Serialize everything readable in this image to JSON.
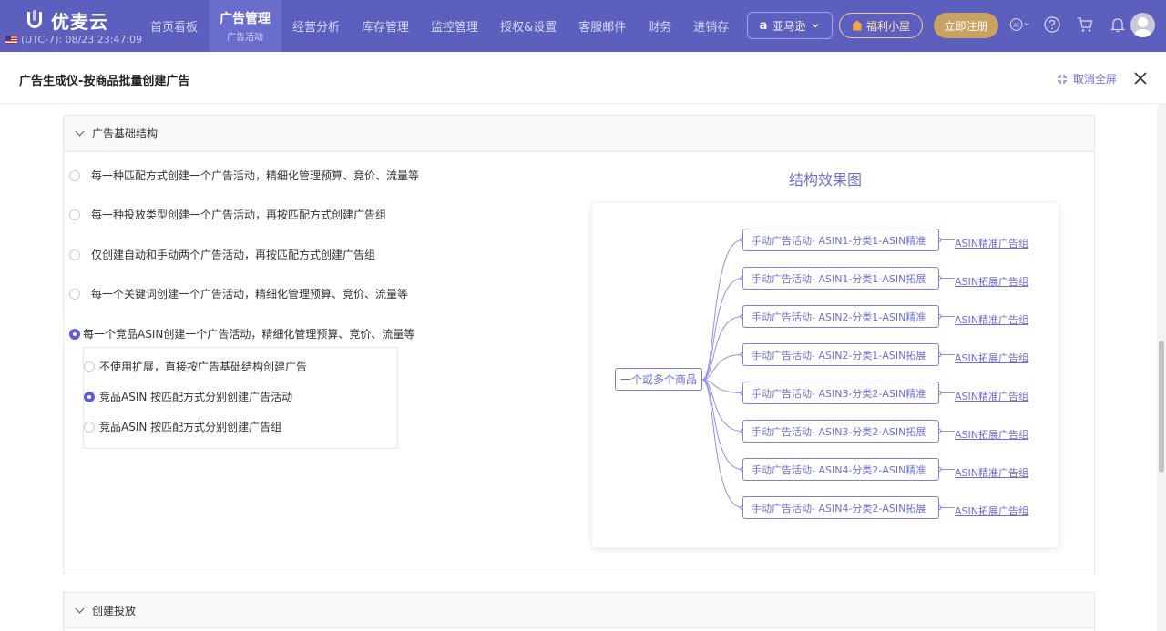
{
  "brand": {
    "name": "优麦云"
  },
  "timezone": "(UTC-7): 08/23 23:47:09",
  "nav": [
    {
      "label": "首页看板",
      "sub": ""
    },
    {
      "label": "广告管理",
      "sub": "广告活动"
    },
    {
      "label": "经营分析",
      "sub": ""
    },
    {
      "label": "库存管理",
      "sub": ""
    },
    {
      "label": "监控管理",
      "sub": ""
    },
    {
      "label": "授权&设置",
      "sub": ""
    },
    {
      "label": "客服邮件",
      "sub": ""
    },
    {
      "label": "财务",
      "sub": ""
    },
    {
      "label": "进销存",
      "sub": ""
    }
  ],
  "active_nav": "广告管理",
  "store_select": {
    "label": "亚马逊"
  },
  "welfare": "福利小屋",
  "register": "立即注册",
  "top_icons": [
    "ai-icon",
    "help-icon",
    "cart-icon",
    "bell-icon",
    "avatar"
  ],
  "dialog": {
    "title": "广告生成仪-按商品批量创建广告",
    "exit_fullscreen": "取消全屏"
  },
  "section1": {
    "title": "广告基础结构",
    "options": [
      {
        "label": "每一种匹配方式创建一个广告活动，精细化管理预算、竞价、流量等",
        "selected": false
      },
      {
        "label": "每一种投放类型创建一个广告活动，再按匹配方式创建广告组",
        "selected": false
      },
      {
        "label": "仅创建自动和手动两个广告活动，再按匹配方式创建广告组",
        "selected": false
      },
      {
        "label": "每一个关键词创建一个广告活动，精细化管理预算、竞价、流量等",
        "selected": false
      },
      {
        "label": "每一个竞品ASIN创建一个广告活动，精细化管理预算、竞价、流量等",
        "selected": true
      }
    ],
    "sub_options": [
      {
        "label": "不使用扩展，直接按广告基础结构创建广告",
        "selected": false
      },
      {
        "label": "竞品ASIN 按匹配方式分别创建广告活动",
        "selected": true
      },
      {
        "label": "竞品ASIN 按匹配方式分别创建广告组",
        "selected": false
      }
    ]
  },
  "diagram": {
    "title": "结构效果图",
    "root": "一个或多个商品",
    "campaigns": [
      {
        "label": "手动广告活动- ASIN1-分类1-ASIN精准",
        "group": "ASIN精准广告组"
      },
      {
        "label": "手动广告活动- ASIN1-分类1-ASIN拓展",
        "group": "ASIN拓展广告组"
      },
      {
        "label": "手动广告活动- ASIN2-分类1-ASIN精准",
        "group": "ASIN精准广告组"
      },
      {
        "label": "手动广告活动- ASIN2-分类1-ASIN拓展",
        "group": "ASIN拓展广告组"
      },
      {
        "label": "手动广告活动- ASIN3-分类2-ASIN精准",
        "group": "ASIN精准广告组"
      },
      {
        "label": "手动广告活动- ASIN3-分类2-ASIN拓展",
        "group": "ASIN拓展广告组"
      },
      {
        "label": "手动广告活动- ASIN4-分类2-ASIN精准",
        "group": "ASIN精准广告组"
      },
      {
        "label": "手动广告活动- ASIN4-分类2-ASIN拓展",
        "group": "ASIN拓展广告组"
      }
    ]
  },
  "section2": {
    "title": "创建投放"
  },
  "colors": {
    "nav_bg": "#5d5fbf",
    "accent": "#6b6dd6",
    "gold": "#c7a262"
  }
}
